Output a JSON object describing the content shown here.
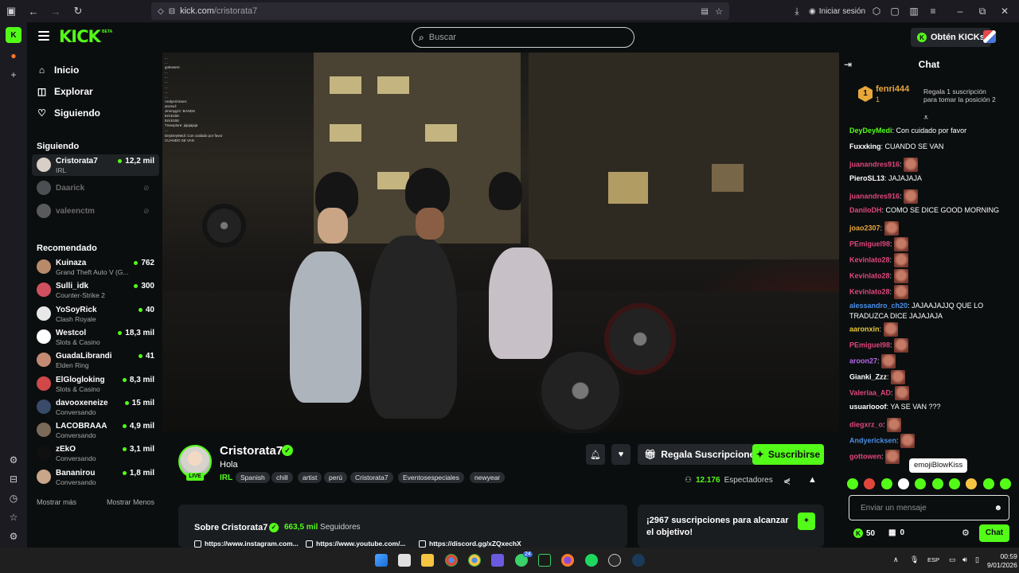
{
  "browser": {
    "url_domain": "kick.com",
    "url_path": "/cristorata7",
    "login_label": "Iniciar sesión"
  },
  "header": {
    "logo": "KICK",
    "logo_badge": "BETA",
    "search_placeholder": "Buscar",
    "get_kicks_label": "Obtén KICKs"
  },
  "sidebar": {
    "nav": [
      {
        "label": "Inicio",
        "icon": "home-icon"
      },
      {
        "label": "Explorar",
        "icon": "compass-icon"
      },
      {
        "label": "Siguiendo",
        "icon": "heart-icon"
      }
    ],
    "following_title": "Siguiendo",
    "following": [
      {
        "name": "Cristorata7",
        "category": "IRL",
        "viewers": "12,2 mil",
        "live": true,
        "color": "#d8cfc6"
      },
      {
        "name": "Daarick",
        "live": false,
        "color": "#9aa0a6"
      },
      {
        "name": "valeenctm",
        "live": false,
        "color": "#b9b9b9"
      }
    ],
    "recommended_title": "Recomendado",
    "recommended": [
      {
        "name": "Kuinaza",
        "category": "Grand Theft Auto V (G...",
        "viewers": "762",
        "color": "#b88a6a"
      },
      {
        "name": "Sulli_idk",
        "category": "Counter-Strike 2",
        "viewers": "300",
        "color": "#d05060"
      },
      {
        "name": "YoSoyRick",
        "category": "Clash Royale",
        "viewers": "40",
        "color": "#e8e8e8"
      },
      {
        "name": "Westcol",
        "category": "Slots & Casino",
        "viewers": "18,3 mil",
        "color": "#ffffff"
      },
      {
        "name": "GuadaLibrandi",
        "category": "Elden Ring",
        "viewers": "41",
        "color": "#c58a72"
      },
      {
        "name": "ElGlogloking",
        "category": "Slots & Casino",
        "viewers": "8,3 mil",
        "color": "#d04848"
      },
      {
        "name": "davooxeneize",
        "category": "Conversando",
        "viewers": "15 mil",
        "color": "#3a4a6a"
      },
      {
        "name": "LACOBRAAA",
        "category": "Conversando",
        "viewers": "4,9 mil",
        "color": "#7a6a5a"
      },
      {
        "name": "zEkO",
        "category": "Conversando",
        "viewers": "3,1 mil",
        "color": "#101010"
      },
      {
        "name": "Bananirou",
        "category": "Conversando",
        "viewers": "1,8 mil",
        "color": "#c9a58a"
      }
    ],
    "show_more": "Mostrar más",
    "show_less": "Mostrar Menos"
  },
  "stream": {
    "name": "Cristorata7",
    "live_badge": "LIVE",
    "title": "Hola",
    "category": "IRL",
    "tags": [
      "Spanish",
      "chill",
      "artist",
      "perú",
      "Cristorata7",
      "Eventosespeciales",
      "newyear"
    ],
    "gift_subs_label": "Regala Suscripciones",
    "subscribe_label": "Suscribirse",
    "viewers_count": "12.176",
    "viewers_label": "Espectadores",
    "overlay_chat": [
      "...",
      "...",
      "gottowen:",
      "...",
      "...",
      "...",
      "...",
      "...",
      "...",
      "Andyericksen:",
      "aronxd:",
      "Jimmygzz: BANDS",
      "Erick155:",
      "Erick155:",
      "Tmexplore: jajajajaja",
      "...",
      "DeyDeyMedi: Con cuidado por favor",
      "CUANDO SE VAN"
    ]
  },
  "about": {
    "title": "Sobre Cristorata7",
    "followers_count": "663,5 mil",
    "followers_label": "Seguidores",
    "links": [
      "https://www.instagram.com...",
      "https://www.youtube.com/...",
      "https://discord.gg/xZQxechX"
    ]
  },
  "goal": {
    "text": "¡2967 suscripciones para alcanzar el objetivo!"
  },
  "chat": {
    "title": "Chat",
    "pinned": {
      "rank": "1",
      "user": "fenri444",
      "count": "1",
      "message_line1": "Regala 1 suscripción",
      "message_line2": "para tomar la posición 2"
    },
    "messages": [
      {
        "user": "DeyDeyMedi",
        "color": "#53fc18",
        "text": "Con cuidado por favor"
      },
      {
        "user": "Fuxxking",
        "color": "#ffffff",
        "text": "CUANDO SE VAN"
      },
      {
        "user": "juanandres916",
        "color": "#e0467a",
        "text": "",
        "emote": true
      },
      {
        "user": "PieroSL13",
        "color": "#ffffff",
        "text": "JAJAJAJA"
      },
      {
        "user": "juanandres916",
        "color": "#e0467a",
        "text": "",
        "emote": true
      },
      {
        "user": "DaniloDH",
        "color": "#e0467a",
        "text": "COMO SE DICE GOOD MORNING"
      },
      {
        "user": "joao2307",
        "color": "#e8a73a",
        "text": "",
        "emote": true
      },
      {
        "user": "PEmiguel98",
        "color": "#e0467a",
        "text": "",
        "emote": true
      },
      {
        "user": "Kevinlato28",
        "color": "#e0467a",
        "text": "",
        "emote": true
      },
      {
        "user": "Kevinlato28",
        "color": "#e0467a",
        "text": "",
        "emote": true
      },
      {
        "user": "Kevinlato28",
        "color": "#e0467a",
        "text": "",
        "emote": true
      },
      {
        "user": "alessandro_ch20",
        "color": "#4a8fe8",
        "text": "JAJAAJAJJQ QUE LO TRADUZCA DICE JAJAJAJA"
      },
      {
        "user": "aaronxin",
        "color": "#e8c93a",
        "text": "",
        "emote": true
      },
      {
        "user": "PEmiguel98",
        "color": "#e0467a",
        "text": "",
        "emote": true
      },
      {
        "user": "aroon27",
        "color": "#b46ae8",
        "text": "",
        "emote": true
      },
      {
        "user": "Gianki_Zzz",
        "color": "#ffffff",
        "text": "",
        "emote": true
      },
      {
        "user": "Valeriaa_AD",
        "color": "#e0467a",
        "text": "",
        "emote": true
      },
      {
        "user": "usuariooof",
        "color": "#ffffff",
        "text": "YA SE VAN ???"
      },
      {
        "user": "diegxrz_o",
        "color": "#e0467a",
        "text": "",
        "emote": true
      },
      {
        "user": "Andyericksen",
        "color": "#4a8fe8",
        "text": "",
        "emote": true
      },
      {
        "user": "gottowen",
        "color": "#e0467a",
        "text": "",
        "emote": true
      }
    ],
    "tooltip": "emojiBlowKiss",
    "input_placeholder": "Enviar un mensaje",
    "kicks_count": "50",
    "gift_count": "0",
    "send_label": "Chat"
  },
  "taskbar": {
    "language": "ESP",
    "time": "00:59",
    "date": "9/01/2026",
    "badge_count": "24"
  }
}
